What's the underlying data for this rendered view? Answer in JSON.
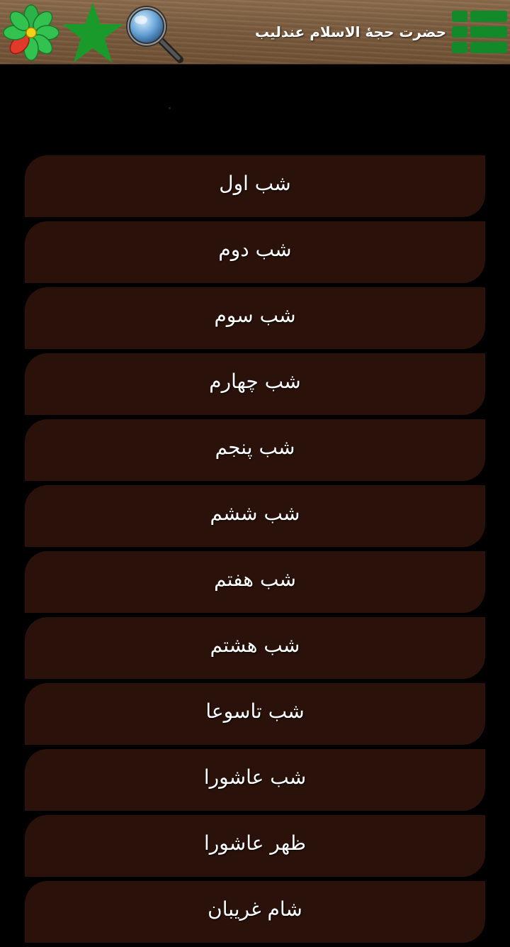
{
  "header": {
    "title": "حضرت حجۀ الاسلام عندلیب",
    "icons": {
      "left_1": "flower-icon",
      "left_2": "star-icon",
      "left_3": "search-icon",
      "right": "menu-grid-icon"
    },
    "colors": {
      "wood": "#7a5b3d",
      "star": "#1a9a2a",
      "menu_grid": "#138a2a"
    }
  },
  "menu": {
    "item_color": "#2a120a",
    "items": [
      {
        "label": "شب اول"
      },
      {
        "label": "شب دوم"
      },
      {
        "label": "شب سوم"
      },
      {
        "label": "شب چهارم"
      },
      {
        "label": "شب پنجم"
      },
      {
        "label": "شب ششم"
      },
      {
        "label": "شب هفتم"
      },
      {
        "label": "شب هشتم"
      },
      {
        "label": "شب تاسوعا"
      },
      {
        "label": "شب عاشورا"
      },
      {
        "label": "ظهر عاشورا"
      },
      {
        "label": "شام غریبان"
      }
    ]
  }
}
